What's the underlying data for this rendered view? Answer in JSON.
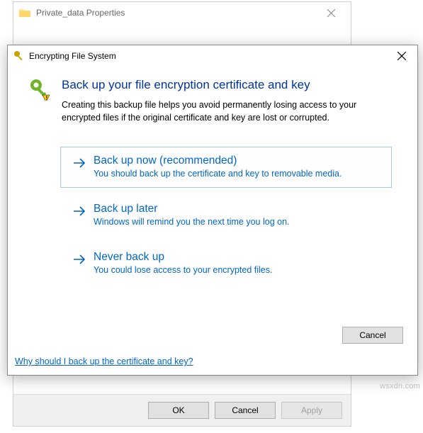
{
  "properties": {
    "title": "Private_data Properties",
    "buttons": {
      "ok": "OK",
      "cancel": "Cancel",
      "apply": "Apply"
    }
  },
  "efs": {
    "title": "Encrypting File System",
    "heading": "Back up your file encryption certificate and key",
    "description": "Creating this backup file helps you avoid permanently losing access to your encrypted files if the original certificate and key are lost or corrupted.",
    "options": [
      {
        "title": "Back up now (recommended)",
        "sub": "You should back up the certificate and key to removable media."
      },
      {
        "title": "Back up later",
        "sub": "Windows will remind you the next time you log on."
      },
      {
        "title": "Never back up",
        "sub": "You could lose access to your encrypted files."
      }
    ],
    "cancel": "Cancel",
    "help_link": "Why should I back up the certificate and key?"
  },
  "watermark": "wsxdn.com"
}
